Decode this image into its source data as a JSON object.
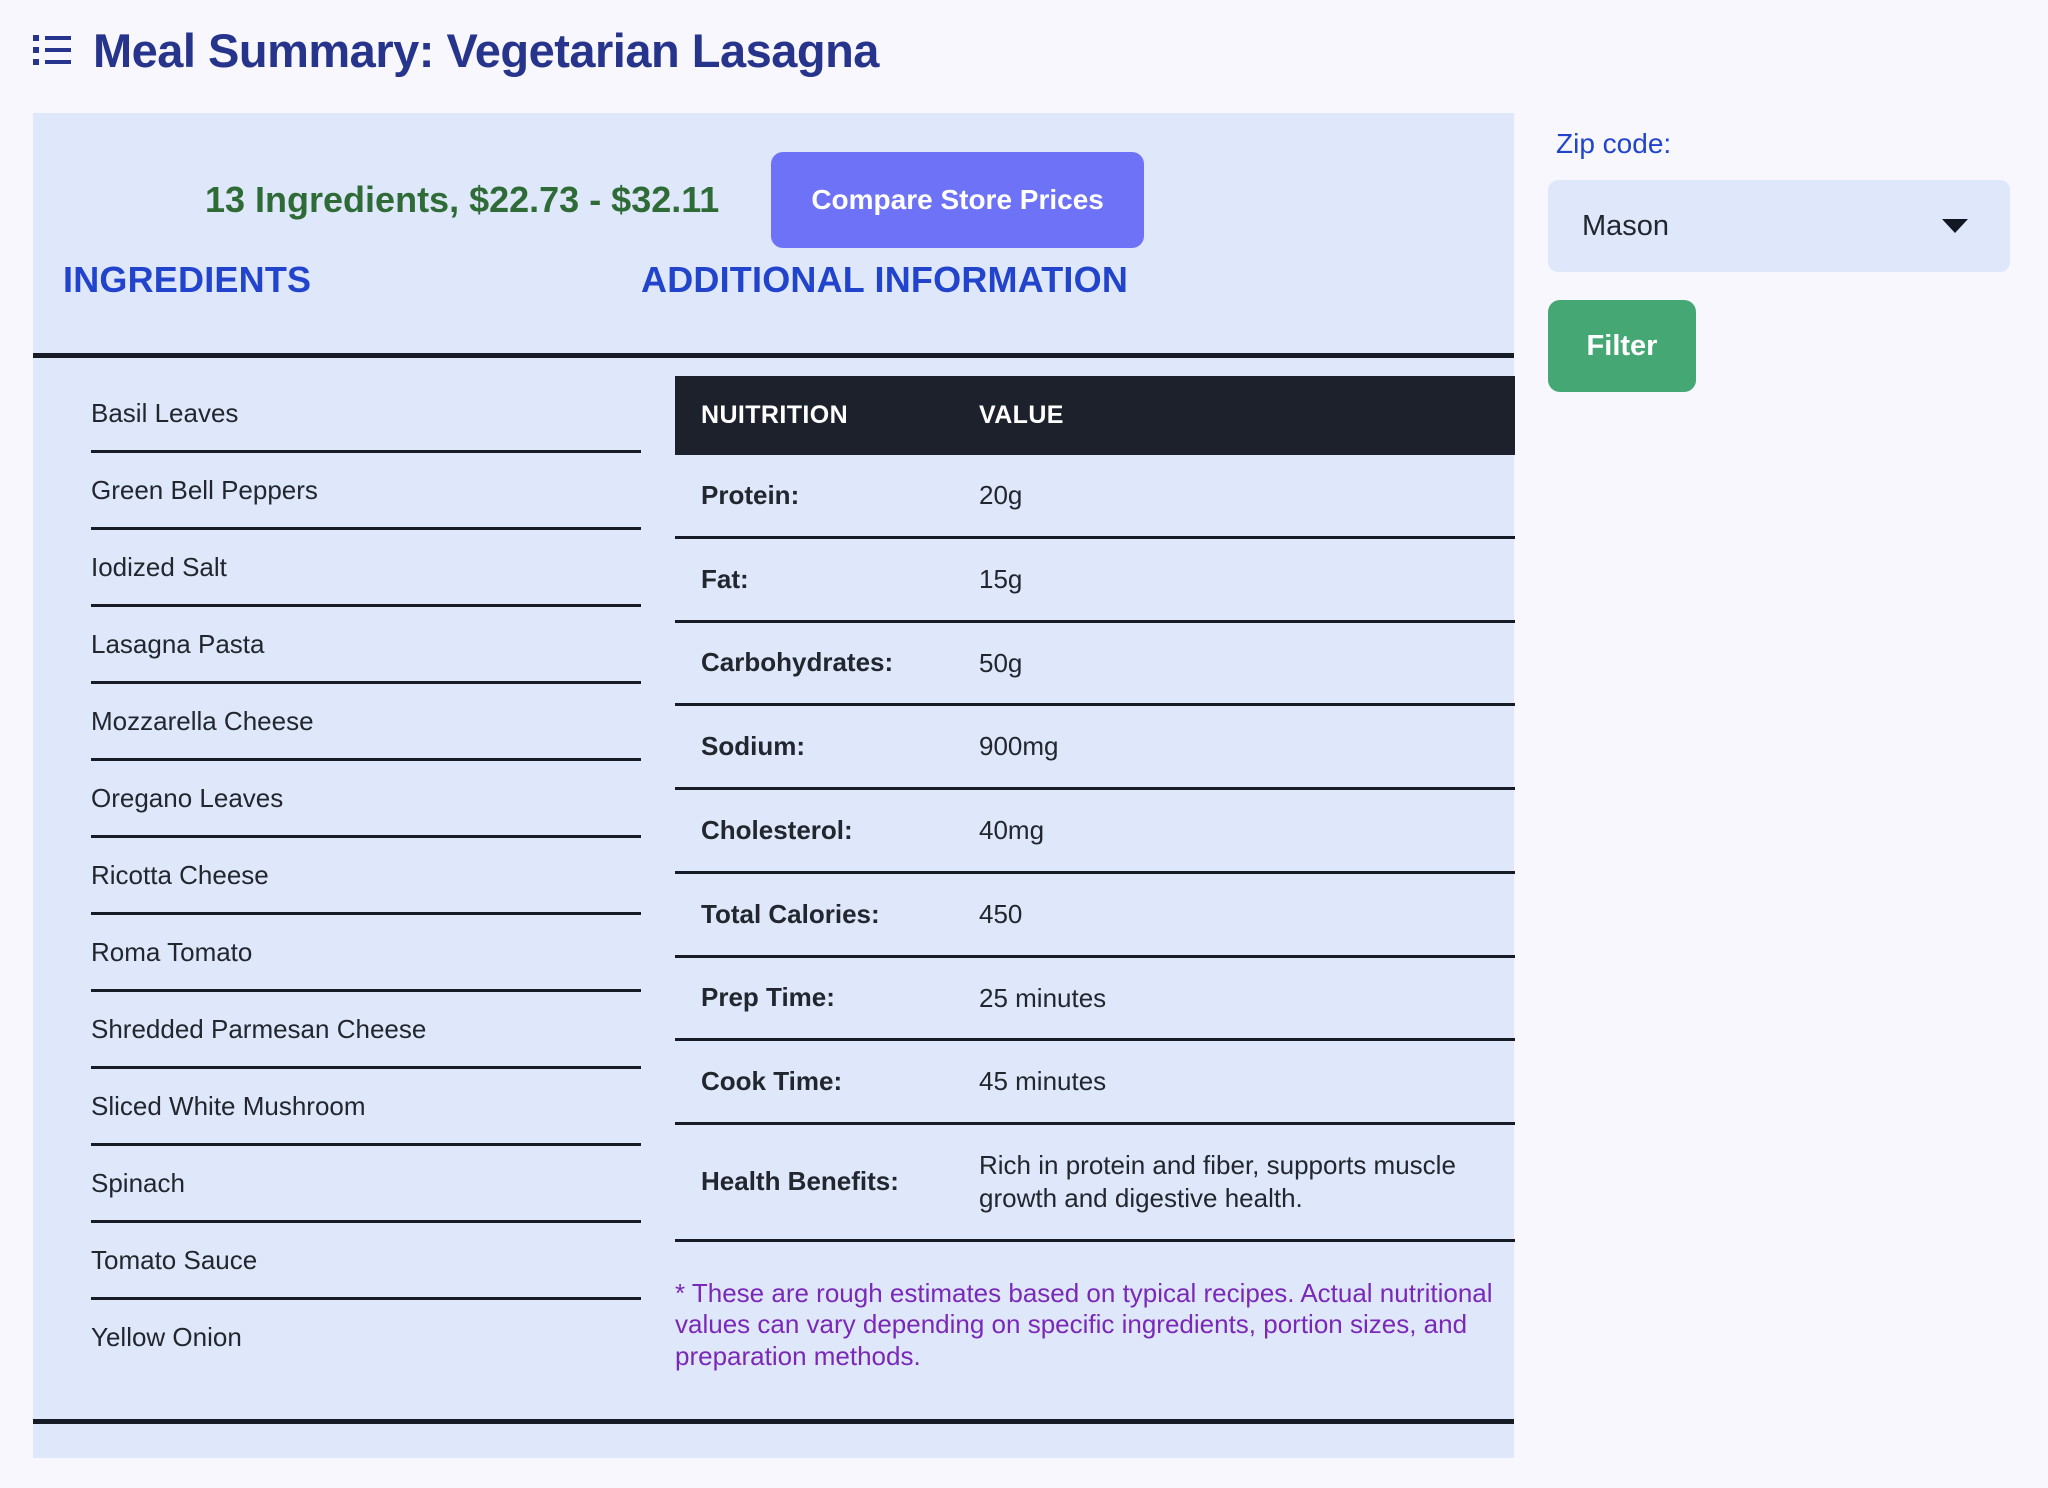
{
  "header": {
    "icon": "list-bullet-icon",
    "title": "Meal Summary: Vegetarian Lasagna"
  },
  "summary": {
    "text": "13 Ingredients, $22.73 - $32.11",
    "ingredient_count": 13,
    "price_min": "$22.73",
    "price_max": "$32.11",
    "compare_button": "Compare Store Prices"
  },
  "sections": {
    "ingredients_heading": "INGREDIENTS",
    "additional_heading": "ADDITIONAL INFORMATION"
  },
  "ingredients": [
    "Basil Leaves",
    "Green Bell Peppers",
    "Iodized Salt",
    "Lasagna Pasta",
    "Mozzarella Cheese",
    "Oregano Leaves",
    "Ricotta Cheese",
    "Roma Tomato",
    "Shredded Parmesan Cheese",
    "Sliced White Mushroom",
    "Spinach",
    "Tomato Sauce",
    "Yellow Onion"
  ],
  "nutrition_table": {
    "columns": [
      "NUITRITION",
      "VALUE"
    ],
    "rows": [
      {
        "label": "Protein:",
        "value": "20g"
      },
      {
        "label": "Fat:",
        "value": "15g"
      },
      {
        "label": "Carbohydrates:",
        "value": "50g"
      },
      {
        "label": "Sodium:",
        "value": "900mg"
      },
      {
        "label": "Cholesterol:",
        "value": "40mg"
      },
      {
        "label": "Total Calories:",
        "value": "450"
      },
      {
        "label": "Prep Time:",
        "value": "25 minutes"
      },
      {
        "label": "Cook Time:",
        "value": "45 minutes"
      },
      {
        "label": "Health Benefits:",
        "value": "Rich in protein and fiber, supports muscle growth and digestive health."
      }
    ]
  },
  "footnote": "* These are rough estimates based on typical recipes. Actual nutritional values can vary depending on specific ingredients, portion sizes, and preparation methods.",
  "rail": {
    "zip_label": "Zip code:",
    "zip_value": "Mason",
    "caret_icon": "chevron-down-icon",
    "filter_button": "Filter"
  },
  "colors": {
    "page_background": "#f7f7fd",
    "panel_background": "#dfe8fa",
    "title_blue": "#27348b",
    "heading_blue": "#2244cc",
    "summary_green": "#2f6b37",
    "compare_button": "#6d72f6",
    "filter_button": "#45a773",
    "table_header": "#1d212b",
    "footnote_purple": "#7a28b8",
    "rule": "#161b26"
  }
}
